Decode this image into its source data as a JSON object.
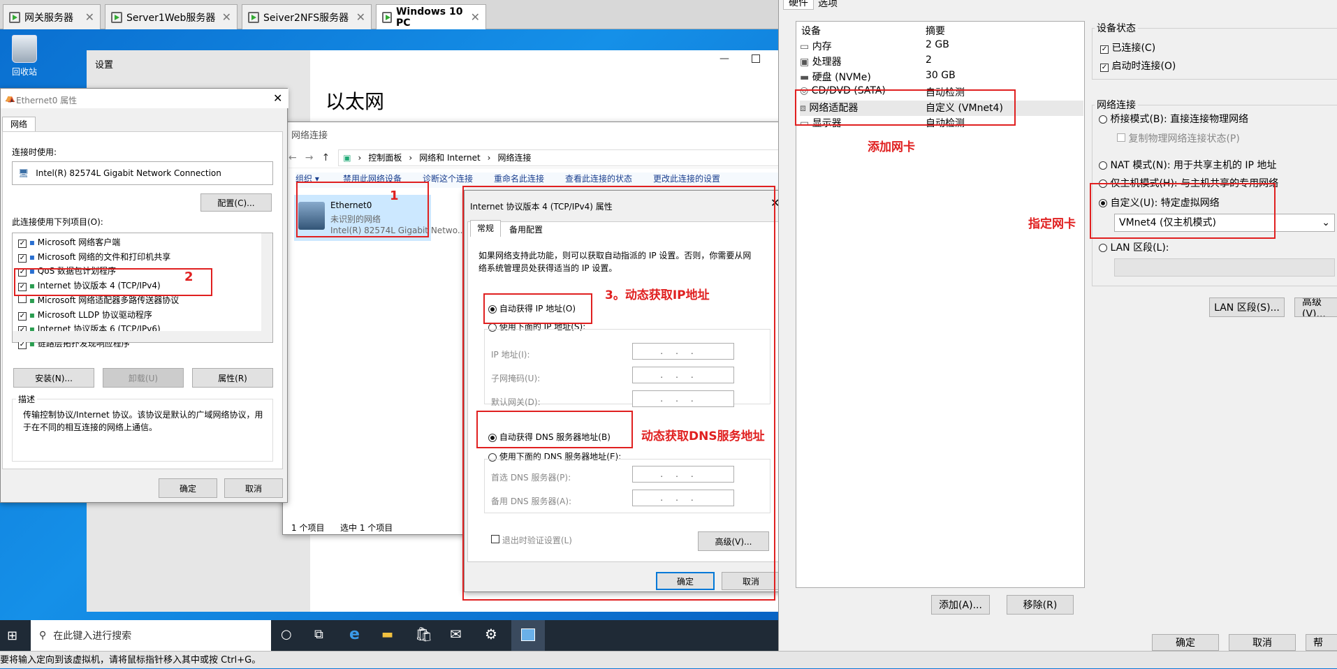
{
  "vm_tabs": [
    "网关服务器",
    "Server1Web服务器",
    "Seiver2NFS服务器",
    "Windows 10 PC"
  ],
  "desktop": {
    "recycle_label": "回收站"
  },
  "settings": {
    "title": "设置",
    "heading": "以太网"
  },
  "eth_props": {
    "title": "Ethernet0 属性",
    "tab": "网络",
    "connect_using_label": "连接时使用:",
    "adapter": "Intel(R) 82574L Gigabit Network Connection",
    "configure": "配置(C)...",
    "items_label": "此连接使用下列项目(O):",
    "items": [
      {
        "label": "Microsoft 网络客户端",
        "checked": true
      },
      {
        "label": "Microsoft 网络的文件和打印机共享",
        "checked": true
      },
      {
        "label": "QoS 数据包计划程序",
        "checked": true
      },
      {
        "label": "Internet 协议版本 4 (TCP/IPv4)",
        "checked": true
      },
      {
        "label": "Microsoft 网络适配器多路传送器协议",
        "checked": false
      },
      {
        "label": "Microsoft LLDP 协议驱动程序",
        "checked": true
      },
      {
        "label": "Internet 协议版本 6 (TCP/IPv6)",
        "checked": true
      },
      {
        "label": "链路层拓扑发现响应程序",
        "checked": true
      }
    ],
    "install": "安装(N)...",
    "uninstall": "卸载(U)",
    "properties": "属性(R)",
    "desc_label": "描述",
    "desc": "传输控制协议/Internet 协议。该协议是默认的广域网络协议，用于在不同的相互连接的网络上通信。",
    "ok": "确定",
    "cancel": "取消"
  },
  "netconn": {
    "title": "网络连接",
    "breadcrumb": [
      "控制面板",
      "网络和 Internet",
      "网络连接"
    ],
    "commands": [
      "组织 ▾",
      "禁用此网络设备",
      "诊断这个连接",
      "重命名此连接",
      "查看此连接的状态",
      "更改此连接的设置"
    ],
    "adapter_name": "Ethernet0",
    "adapter_status": "未识别的网络",
    "adapter_device": "Intel(R) 82574L Gigabit Netwo...",
    "count": "1 个项目",
    "selected": "选中 1 个项目"
  },
  "ipv4": {
    "title": "Internet 协议版本 4 (TCP/IPv4) 属性",
    "tabs": [
      "常规",
      "备用配置"
    ],
    "intro": "如果网络支持此功能，则可以获取自动指派的 IP 设置。否则，你需要从网络系统管理员处获得适当的 IP 设置。",
    "auto_ip": "自动获得 IP 地址(O)",
    "manual_ip": "使用下面的 IP 地址(S):",
    "ip_label": "IP 地址(I):",
    "mask_label": "子网掩码(U):",
    "gw_label": "默认网关(D):",
    "auto_dns": "自动获得 DNS 服务器地址(B)",
    "manual_dns": "使用下面的 DNS 服务器地址(E):",
    "dns1_label": "首选 DNS 服务器(P):",
    "dns2_label": "备用 DNS 服务器(A):",
    "ip_dots": "...",
    "validate": "退出时验证设置(L)",
    "advanced": "高级(V)...",
    "ok": "确定",
    "cancel": "取消"
  },
  "annotations": {
    "n1": "1",
    "n2": "2",
    "n3": "3。动态获取IP地址",
    "dns": "动态获取DNS服务地址",
    "add_nic": "添加网卡",
    "spec_nic": "指定网卡"
  },
  "taskbar": {
    "search_placeholder": "在此键入进行搜索"
  },
  "status_bar": "要将输入定向到该虚拟机，请将鼠标指针移入其中或按 Ctrl+G。",
  "vm_settings": {
    "tabs": [
      "硬件",
      "选项"
    ],
    "col_device": "设备",
    "col_summary": "摘要",
    "devices": [
      {
        "name": "内存",
        "summary": "2 GB"
      },
      {
        "name": "处理器",
        "summary": "2"
      },
      {
        "name": "硬盘 (NVMe)",
        "summary": "30 GB"
      },
      {
        "name": "CD/DVD (SATA)",
        "summary": "自动检测"
      },
      {
        "name": "网络适配器",
        "summary": "自定义 (VMnet4)"
      },
      {
        "name": "显示器",
        "summary": "自动检测"
      }
    ],
    "add": "添加(A)...",
    "remove": "移除(R)",
    "device_status": "设备状态",
    "connected": "已连接(C)",
    "connect_on_start": "启动时连接(O)",
    "net_conn": "网络连接",
    "bridged": "桥接模式(B): 直接连接物理网络",
    "replicate": "复制物理网络连接状态(P)",
    "nat": "NAT 模式(N): 用于共享主机的 IP 地址",
    "hostonly": "仅主机模式(H): 与主机共享的专用网络",
    "custom": "自定义(U): 特定虚拟网络",
    "vmnet": "VMnet4 (仅主机模式)",
    "lan": "LAN 区段(L):",
    "lan_btn": "LAN 区段(S)...",
    "advanced": "高级(V)...",
    "ok": "确定",
    "cancel": "取消",
    "help": "帮"
  }
}
